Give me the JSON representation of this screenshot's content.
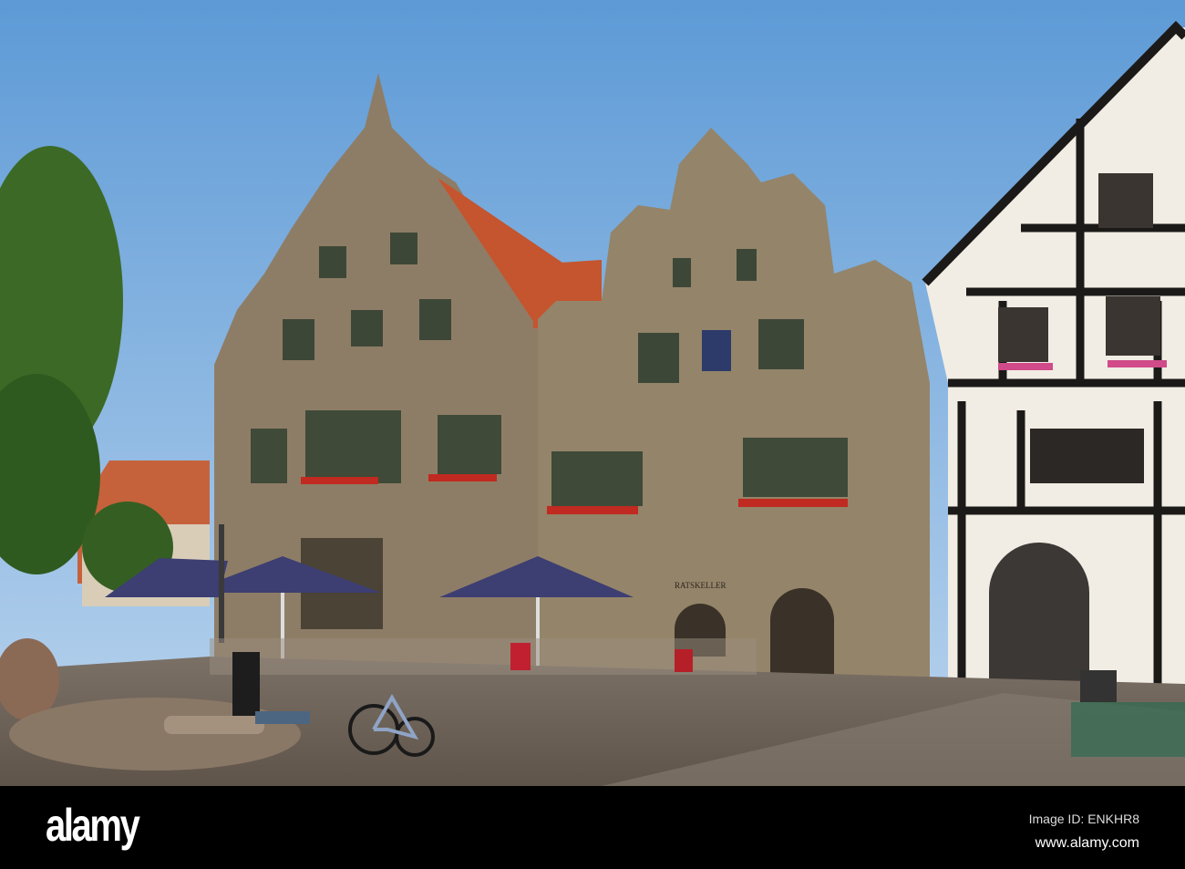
{
  "photo": {
    "subject": "Rathaus",
    "sign_text": "RATSKELLER",
    "colors": {
      "sky_top": "#5d9ad6",
      "sky_bottom": "#b7d2ec",
      "stone": "#8f7f68",
      "roof": "#c4552f",
      "cobble": "#6f6459"
    }
  },
  "watermark": {
    "text": "alamy"
  },
  "footer": {
    "logo": "alamy",
    "image_id": "Image ID: ENKHR8",
    "website": "www.alamy.com"
  }
}
